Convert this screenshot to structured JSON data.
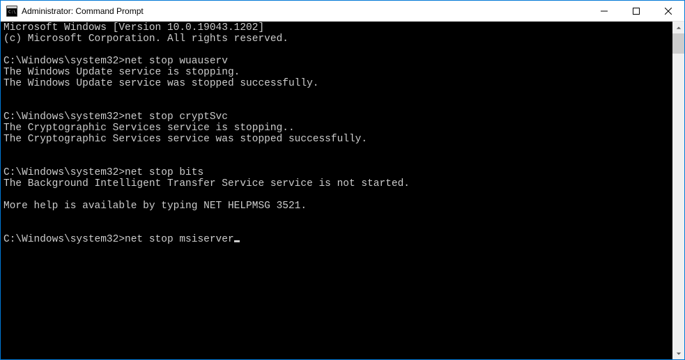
{
  "window": {
    "title": "Administrator: Command Prompt"
  },
  "terminal": {
    "header_line1": "Microsoft Windows [Version 10.0.19043.1202]",
    "header_line2": "(c) Microsoft Corporation. All rights reserved.",
    "prompt": "C:\\Windows\\system32>",
    "blocks": [
      {
        "command": "net stop wuauserv",
        "output": [
          "The Windows Update service is stopping.",
          "The Windows Update service was stopped successfully."
        ]
      },
      {
        "command": "net stop cryptSvc",
        "output": [
          "The Cryptographic Services service is stopping..",
          "The Cryptographic Services service was stopped successfully."
        ]
      },
      {
        "command": "net stop bits",
        "output": [
          "The Background Intelligent Transfer Service service is not started.",
          "",
          "More help is available by typing NET HELPMSG 3521."
        ]
      }
    ],
    "current_command": "net stop msiserver"
  }
}
